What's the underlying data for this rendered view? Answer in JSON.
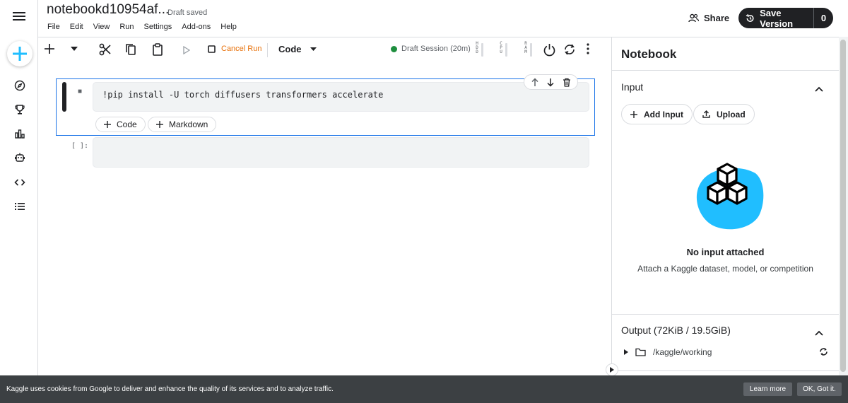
{
  "header": {
    "title": "notebookd10954af...",
    "status": "Draft saved",
    "menu": [
      "File",
      "Edit",
      "View",
      "Run",
      "Settings",
      "Add-ons",
      "Help"
    ],
    "share_label": "Share",
    "save_version_label": "Save Version",
    "save_version_count": "0"
  },
  "toolbar": {
    "cancel_run_label": "Cancel Run",
    "cell_type": "Code",
    "session_label": "Draft Session (20m)",
    "session_status_color": "#1e8e3e",
    "meters": [
      {
        "label": "HDD"
      },
      {
        "label": "CPU"
      },
      {
        "label": "RAM"
      }
    ]
  },
  "cells": [
    {
      "run_marker": "■",
      "code": "!pip install -U torch diffusers transformers accelerate",
      "add_code_label": "Code",
      "add_markdown_label": "Markdown"
    },
    {
      "run_marker": "[ ]:",
      "code": ""
    }
  ],
  "panel": {
    "title": "Notebook",
    "input_section": "Input",
    "add_input_label": "Add Input",
    "upload_label": "Upload",
    "empty_title": "No input attached",
    "empty_subtitle": "Attach a Kaggle dataset, model, or competition",
    "output_section": "Output (72KiB / 19.5GiB)",
    "output_path": "/kaggle/working"
  },
  "cookie": {
    "text": "Kaggle uses cookies from Google to deliver and enhance the quality of its services and to analyze traffic.",
    "learn_more": "Learn more",
    "ok": "OK, Got it."
  },
  "colors": {
    "accent_blue": "#1a73e8",
    "cancel_orange": "#e8710a",
    "dark": "#202124",
    "illustration_blue": "#20beff"
  }
}
